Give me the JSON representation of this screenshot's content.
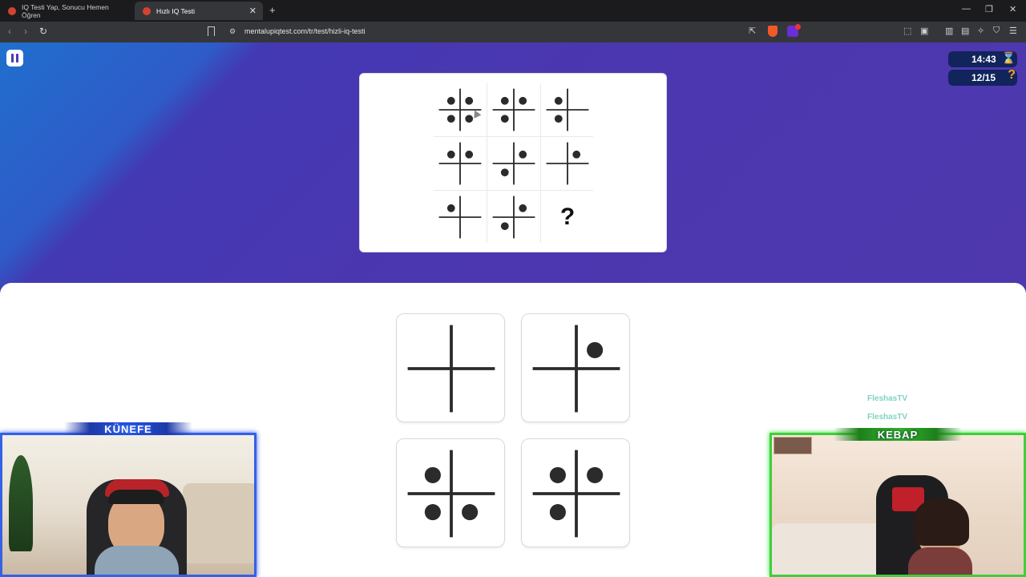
{
  "browser": {
    "tabs": [
      {
        "title": "IQ Testi Yap, Sonucu Hemen Öğren",
        "active": false
      },
      {
        "title": "Hızlı IQ Testi",
        "active": true
      }
    ],
    "url": "mentalupiqtest.com/tr/test/hizli-iq-testi"
  },
  "quiz": {
    "timer": "14:43",
    "progress": "12/15",
    "missing_symbol": "?",
    "puzzle": [
      [
        [
          "tl",
          "tr",
          "bl",
          "br"
        ],
        [
          "tl",
          "tr",
          "bl"
        ],
        [
          "tl",
          "bl"
        ]
      ],
      [
        [
          "tl",
          "tr"
        ],
        [
          "tr",
          "bl"
        ],
        [
          "tr"
        ]
      ],
      [
        [
          "tl"
        ],
        [
          "tr",
          "bl"
        ],
        null
      ]
    ],
    "options": [
      [],
      [
        "tr"
      ],
      [
        "tl",
        "bl",
        "br"
      ],
      [
        "tl",
        "tr",
        "bl"
      ]
    ]
  },
  "stream": {
    "left_banner": "KÜNEFE",
    "right_banner": "KEBAP",
    "chat": [
      "FleshasTV",
      "FleshasTV"
    ]
  },
  "colors": {
    "accent": "#4b37b0",
    "cam_left_border": "#3561e6",
    "cam_right_border": "#3fcf3a"
  }
}
